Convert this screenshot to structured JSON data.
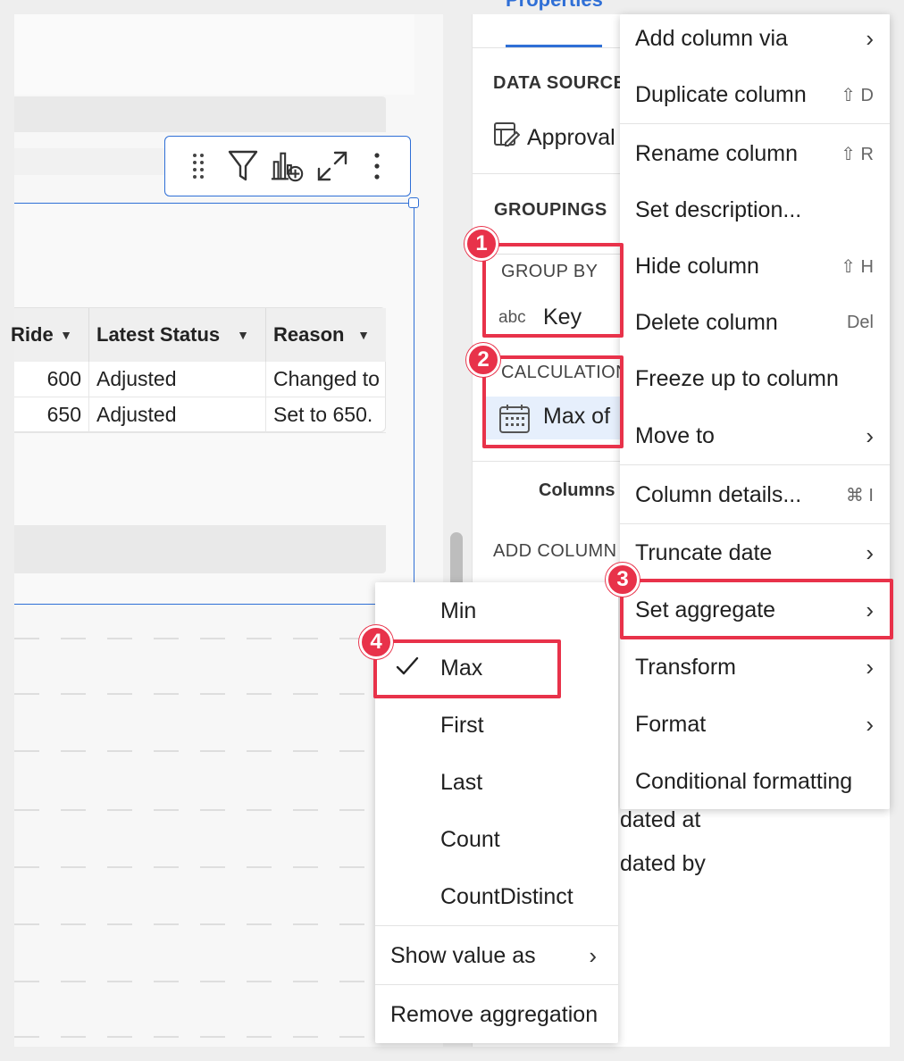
{
  "colors": {
    "accent": "#2f6fd6",
    "highlight": "#e8324a",
    "pill": "#e6effc"
  },
  "panel": {
    "tab_label": "Properties",
    "data_source": {
      "heading": "DATA SOURCE",
      "name": "Approval",
      "icon": "table-edit-icon"
    },
    "groupings_heading": "GROUPINGS",
    "group_by": {
      "label": "GROUP BY",
      "type": "abc",
      "column": "Key"
    },
    "calculations": {
      "label": "CALCULATIONS",
      "item": "Max of",
      "icon": "calendar-icon"
    },
    "columns_label": "Columns",
    "add_column_label": "ADD COLUMN",
    "partial_items": [
      "dated at",
      "dated by"
    ]
  },
  "toolbar": {
    "icons": [
      "drag-handle-icon",
      "filter-icon",
      "add-chart-icon",
      "expand-icon",
      "more-icon"
    ]
  },
  "table": {
    "columns": [
      {
        "label": "Ride"
      },
      {
        "label": "Latest Status"
      },
      {
        "label": "Reason"
      }
    ],
    "rows": [
      [
        "600",
        "Adjusted",
        "Changed to"
      ],
      [
        "650",
        "Adjusted",
        "Set to 650."
      ]
    ]
  },
  "context_menu": {
    "items": [
      {
        "label": "Add column via",
        "submenu": true
      },
      {
        "label": "Duplicate column",
        "shortcut": "⇧ D"
      },
      {
        "label": "Rename column",
        "shortcut": "⇧ R"
      },
      {
        "label": "Set description..."
      },
      {
        "label": "Hide column",
        "shortcut": "⇧ H"
      },
      {
        "label": "Delete column",
        "shortcut": "Del"
      },
      {
        "label": "Freeze up to column"
      },
      {
        "label": "Move to",
        "submenu": true
      },
      {
        "label": "Column details...",
        "shortcut": "⌘ I"
      },
      {
        "label": "Truncate date",
        "submenu": true
      },
      {
        "label": "Set aggregate",
        "submenu": true
      },
      {
        "label": "Transform",
        "submenu": true
      },
      {
        "label": "Format",
        "submenu": true
      },
      {
        "label": "Conditional formatting"
      }
    ]
  },
  "submenu": {
    "items": [
      {
        "label": "Min"
      },
      {
        "label": "Max",
        "checked": true
      },
      {
        "label": "First"
      },
      {
        "label": "Last"
      },
      {
        "label": "Count"
      },
      {
        "label": "CountDistinct"
      },
      {
        "label": "Show value as",
        "submenu": true
      },
      {
        "label": "Remove aggregation"
      }
    ]
  },
  "annotations": [
    "1",
    "2",
    "3",
    "4"
  ]
}
